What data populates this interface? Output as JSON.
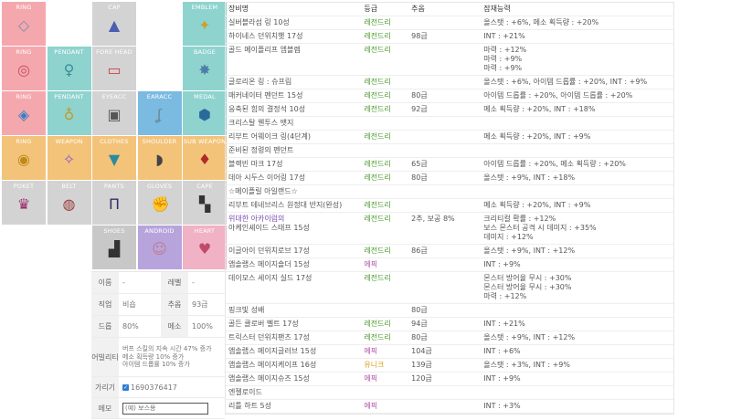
{
  "slots": [
    {
      "label": "RING",
      "icon": "diamond-ring-icon",
      "color": "ring"
    },
    {
      "label": "",
      "icon": "",
      "color": "empty"
    },
    {
      "label": "CAP",
      "icon": "blue-helmet-icon",
      "color": "gray"
    },
    {
      "label": "",
      "icon": "",
      "color": "empty"
    },
    {
      "label": "EMBLEM",
      "icon": "emblem-icon",
      "color": "teal"
    },
    {
      "label": "RING",
      "icon": "pink-ring-icon",
      "color": "ring"
    },
    {
      "label": "PENDANT",
      "icon": "pendant-icon",
      "color": "teal"
    },
    {
      "label": "FORE HEAD",
      "icon": "forehead-card-icon",
      "color": "gray"
    },
    {
      "label": "",
      "icon": "",
      "color": "empty"
    },
    {
      "label": "BADGE",
      "icon": "badge-icon",
      "color": "teal"
    },
    {
      "label": "RING",
      "icon": "gem-ring-icon",
      "color": "ring"
    },
    {
      "label": "PENDANT",
      "icon": "gold-pendant-icon",
      "color": "teal"
    },
    {
      "label": "EYEACC",
      "icon": "eye-accessory-icon",
      "color": "gray"
    },
    {
      "label": "EARACC",
      "icon": "earring-icon",
      "color": "blue"
    },
    {
      "label": "MEDAL",
      "icon": "medal-icon",
      "color": "teal"
    },
    {
      "label": "RING",
      "icon": "gold-ring-icon",
      "color": "orange"
    },
    {
      "label": "WEAPON",
      "icon": "weapon-icon",
      "color": "orange"
    },
    {
      "label": "CLOTHES",
      "icon": "clothes-icon",
      "color": "orange"
    },
    {
      "label": "SHOULDER",
      "icon": "shoulder-icon",
      "color": "orange"
    },
    {
      "label": "SUB WEAPON",
      "icon": "sub-weapon-icon",
      "color": "orange"
    },
    {
      "label": "POKET",
      "icon": "pocket-item-icon",
      "color": "gray"
    },
    {
      "label": "BELT",
      "icon": "belt-icon",
      "color": "gray"
    },
    {
      "label": "PANTS",
      "icon": "pants-icon",
      "color": "gray"
    },
    {
      "label": "GLOVES",
      "icon": "gloves-icon",
      "color": "gray"
    },
    {
      "label": "CAPE",
      "icon": "cape-icon",
      "color": "gray"
    },
    {
      "label": "",
      "icon": "",
      "color": "empty"
    },
    {
      "label": "",
      "icon": "",
      "color": "empty"
    },
    {
      "label": "SHOES",
      "icon": "shoes-icon",
      "color": "gray2"
    },
    {
      "label": "ANDROID",
      "icon": "android-icon",
      "color": "purple"
    },
    {
      "label": "HEART",
      "icon": "heart-icon",
      "color": "pink"
    }
  ],
  "info": {
    "name_label": "이름",
    "name_value": "-",
    "level_label": "레벨",
    "level_value": "-",
    "job_label": "직업",
    "job_value": "비숍",
    "stars_label": "추옵",
    "stars_value": "93급",
    "drop_label": "드롭",
    "drop_value": "80%",
    "meso_label": "메소",
    "meso_value": "100%",
    "ability_label": "어빌리티",
    "ability_lines": [
      "버프 스킬의 지속 시간 47% 증가",
      "메소 획득량 10% 증가",
      "아이템 드롭률 10% 증가"
    ],
    "hide_label": "가리기",
    "hide_value": "1690376417",
    "memo_label": "메모",
    "memo_placeholder": "(예) 보스용"
  },
  "table": {
    "headers": [
      "장비명",
      "등급",
      "추옵",
      "잠재능력"
    ],
    "rows": [
      {
        "name": "실버블라섬 링 10성",
        "grade": "레전드리",
        "gc": "leg",
        "star": "",
        "pot": [
          "올스탯 : +6%, 메소 획득량 : +20%"
        ]
      },
      {
        "name": "하이네스 던위치햇 17성",
        "grade": "레전드리",
        "gc": "leg",
        "star": "98급",
        "pot": [
          "INT : +21%"
        ]
      },
      {
        "name": "골드 메이플리프 엠블렘",
        "grade": "레전드리",
        "gc": "leg",
        "star": "",
        "pot": [
          "마력 : +12%",
          "마력 : +9%",
          "마력 : +9%"
        ]
      },
      {
        "name": "글로리온 링 : 슈프림",
        "grade": "레전드리",
        "gc": "leg",
        "star": "",
        "pot": [
          "올스탯 : +6%, 아이템 드롭률 : +20%, INT : +9%"
        ]
      },
      {
        "name": "매커네이터 펜던트 15성",
        "grade": "레전드리",
        "gc": "leg",
        "star": "80급",
        "pot": [
          "아이템 드롭률 : +20%, 아이템 드롭률 : +20%"
        ]
      },
      {
        "name": "응축된 힘의 결정석 10성",
        "grade": "레전드리",
        "gc": "leg",
        "star": "92급",
        "pot": [
          "메소 획득량 : +20%, INT : +18%"
        ]
      },
      {
        "name": "크리스탈 웬투스 뱃지",
        "grade": "",
        "gc": "",
        "star": "",
        "pot": []
      },
      {
        "name": "리부트 어웨이크 링(4단계)",
        "grade": "레전드리",
        "gc": "leg",
        "star": "",
        "pot": [
          "메소 획득량 : +20%, INT : +9%"
        ]
      },
      {
        "name": "준비된 정령의 펜던트",
        "grade": "",
        "gc": "",
        "star": "",
        "pot": []
      },
      {
        "name": "블랙빈 마크 17성",
        "grade": "레전드리",
        "gc": "leg",
        "star": "65급",
        "pot": [
          "아이템 드롭률 : +20%, 메소 획득량 : +20%"
        ]
      },
      {
        "name": "데아 시두스 이어링 17성",
        "grade": "레전드리",
        "gc": "leg",
        "star": "80급",
        "pot": [
          "올스탯 : +9%, INT : +18%"
        ]
      },
      {
        "name": "☆메이플릴 아일랜드☆",
        "grade": "",
        "gc": "",
        "star": "",
        "pot": []
      },
      {
        "name": "리부트 테네브리스 원정대 반지(완성)",
        "grade": "레전드리",
        "gc": "leg",
        "star": "",
        "pot": [
          "메소 획득량 : +20%, INT : +9%"
        ]
      },
      {
        "name": "위대한 아카이럼의",
        "name2": "아케인셰이드 스태프 15성",
        "grade": "레전드리",
        "gc": "leg",
        "star": "2추, 보공 8%",
        "pot": [
          "크리티컬 확률 : +12%",
          "보스 몬스터 공격 시 데미지 : +35%",
          "데미지 : +12%"
        ]
      },
      {
        "name": "이글아이 던위치로브 17성",
        "grade": "레전드리",
        "gc": "leg",
        "star": "86급",
        "pot": [
          "올스탯 : +9%, INT : +12%"
        ]
      },
      {
        "name": "앱솔랩스 메이지숄더 15성",
        "grade": "에픽",
        "gc": "epic",
        "star": "",
        "pot": [
          "INT : +9%"
        ]
      },
      {
        "name": "데이모스 세이지 실드 17성",
        "grade": "레전드리",
        "gc": "leg",
        "star": "",
        "pot": [
          "몬스터 방어율 무시 : +30%",
          "몬스터 방어율 무시 : +30%",
          "마력 : +12%"
        ]
      },
      {
        "name": "핑크빛 성배",
        "grade": "",
        "gc": "",
        "star": "80급",
        "pot": []
      },
      {
        "name": "골든 클로버 벨트 17성",
        "grade": "레전드리",
        "gc": "leg",
        "star": "94급",
        "pot": [
          "INT : +21%"
        ]
      },
      {
        "name": "트릭스터 던위치팬츠 17성",
        "grade": "레전드리",
        "gc": "leg",
        "star": "80급",
        "pot": [
          "올스탯 : +9%, INT : +12%"
        ]
      },
      {
        "name": "앱솔랩스 메이지글러브 15성",
        "grade": "에픽",
        "gc": "epic",
        "star": "104급",
        "pot": [
          "INT : +6%"
        ]
      },
      {
        "name": "앱솔랩스 메이지케이프 16성",
        "grade": "유니크",
        "gc": "uni",
        "star": "139급",
        "pot": [
          "올스탯 : +3%, INT : +9%"
        ]
      },
      {
        "name": "앱솔랩스 메이지슈즈 15성",
        "grade": "에픽",
        "gc": "epic",
        "star": "120급",
        "pot": [
          "INT : +9%"
        ]
      },
      {
        "name": "엔젤로이드",
        "grade": "",
        "gc": "",
        "star": "",
        "pot": []
      },
      {
        "name": "리틀 하트 5성",
        "grade": "에픽",
        "gc": "epic",
        "star": "",
        "pot": [
          "INT : +3%"
        ]
      }
    ]
  }
}
